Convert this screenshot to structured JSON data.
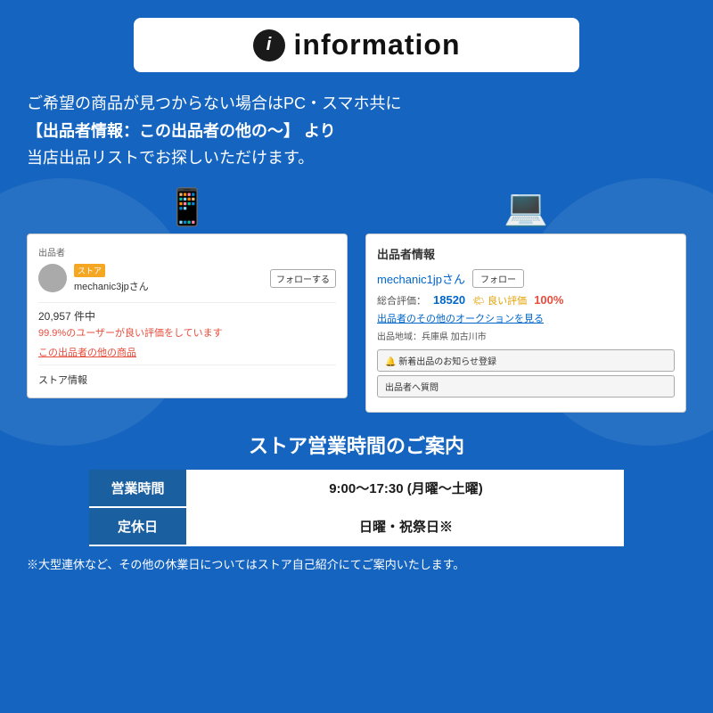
{
  "header": {
    "info_icon_label": "i",
    "title": "information"
  },
  "main_text": {
    "line1": "ご希望の商品が見つからない場合はPC・スマホ共に",
    "line2": "【出品者情報：この出品者の他の〜】 より",
    "line3": "当店出品リストでお探しいただけます。"
  },
  "mobile_screenshot": {
    "label": "出品者",
    "store_badge": "ストア",
    "seller_name": "mechanic3jpさん",
    "follow_btn": "フォローする",
    "count": "20,957 件中",
    "rating_text": "99.9%のユーザーが良い評価をしています",
    "link_text": "この出品者の他の商品",
    "store_info": "ストア情報"
  },
  "pc_screenshot": {
    "header": "出品者情報",
    "seller_name": "mechanic1jpさん",
    "follow_btn": "フォロー",
    "rating_label": "総合評価：",
    "rating_num": "18520",
    "good_label": "🌤 良い評価",
    "good_pct": "100%",
    "auction_link": "出品者のその他のオークションを見る",
    "location_label": "出品地域：兵庫県 加古川市",
    "notify_btn": "🔔 新着出品のお知らせ登録",
    "question_btn": "出品者へ質問"
  },
  "business_hours": {
    "title": "ストア営業時間のご案内",
    "rows": [
      {
        "label": "営業時間",
        "value": "9:00〜17:30 (月曜〜土曜)"
      },
      {
        "label": "定休日",
        "value": "日曜・祝祭日※"
      }
    ],
    "note": "※大型連休など、その他の休業日についてはストア自己紹介にてご案内いたします。"
  }
}
